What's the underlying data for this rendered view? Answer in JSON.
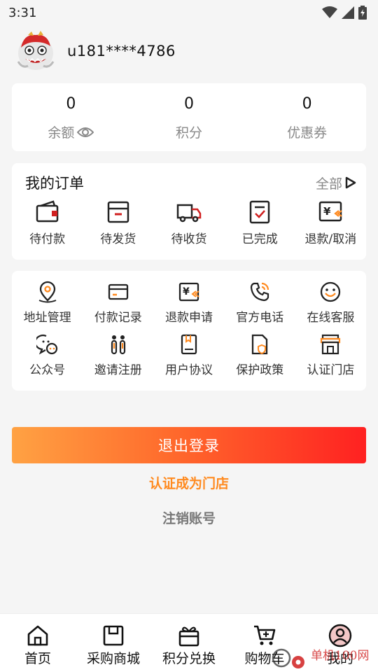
{
  "status_bar": {
    "time": "3:31",
    "icons": [
      "wifi-icon",
      "signal-icon",
      "battery-icon"
    ]
  },
  "profile": {
    "username": "u181****4786",
    "avatar": "lion-dance-avatar"
  },
  "stats": [
    {
      "value": "0",
      "label": "余额",
      "icon": "eye-icon"
    },
    {
      "value": "0",
      "label": "积分"
    },
    {
      "value": "0",
      "label": "优惠券"
    }
  ],
  "orders": {
    "title": "我的订单",
    "all_label": "全部",
    "items": [
      {
        "label": "待付款",
        "icon": "wallet-icon"
      },
      {
        "label": "待发货",
        "icon": "box-icon"
      },
      {
        "label": "待收货",
        "icon": "truck-icon"
      },
      {
        "label": "已完成",
        "icon": "clipboard-check-icon"
      },
      {
        "label": "退款/取消",
        "icon": "refund-icon"
      }
    ]
  },
  "services": [
    {
      "label": "地址管理",
      "icon": "location-icon"
    },
    {
      "label": "付款记录",
      "icon": "card-icon"
    },
    {
      "label": "退款申请",
      "icon": "refund-request-icon"
    },
    {
      "label": "官方电话",
      "icon": "phone-icon"
    },
    {
      "label": "在线客服",
      "icon": "smile-icon"
    },
    {
      "label": "公众号",
      "icon": "chat-icon"
    },
    {
      "label": "邀请注册",
      "icon": "invite-icon"
    },
    {
      "label": "用户协议",
      "icon": "book-icon"
    },
    {
      "label": "保护政策",
      "icon": "shield-doc-icon"
    },
    {
      "label": "认证门店",
      "icon": "store-icon"
    }
  ],
  "actions": {
    "logout": "退出登录",
    "certify_store": "认证成为门店",
    "cancel_account": "注销账号"
  },
  "tabs": [
    {
      "label": "首页",
      "icon": "home-icon"
    },
    {
      "label": "采购商城",
      "icon": "bag-icon"
    },
    {
      "label": "积分兑换",
      "icon": "gift-icon"
    },
    {
      "label": "购物车",
      "icon": "cart-icon"
    },
    {
      "label": "我的",
      "icon": "user-icon",
      "active": true
    }
  ],
  "watermark": "单机100网",
  "colors": {
    "accent_orange": "#ff8a1f",
    "accent_red": "#d02020",
    "gradient_start": "#ffa243",
    "gradient_end": "#ff2121"
  }
}
